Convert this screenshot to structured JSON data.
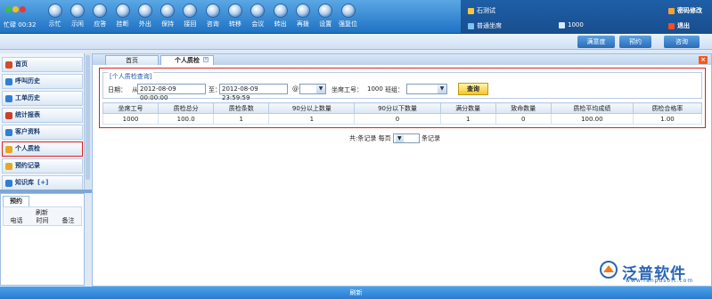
{
  "status": {
    "label": "忙碌",
    "time": "00:32"
  },
  "toolbar": [
    {
      "name": "tool-busy",
      "label": "示忙"
    },
    {
      "name": "tool-idle",
      "label": "示闲"
    },
    {
      "name": "tool-answer",
      "label": "应答"
    },
    {
      "name": "tool-hangup",
      "label": "挂断"
    },
    {
      "name": "tool-outbound",
      "label": "外出"
    },
    {
      "name": "tool-hold",
      "label": "保持"
    },
    {
      "name": "tool-resume",
      "label": "接回"
    },
    {
      "name": "tool-consult",
      "label": "咨询"
    },
    {
      "name": "tool-transfer",
      "label": "转移"
    },
    {
      "name": "tool-conference",
      "label": "会议"
    },
    {
      "name": "tool-transfer-out",
      "label": "转出"
    },
    {
      "name": "tool-redial",
      "label": "再拨"
    },
    {
      "name": "tool-settings",
      "label": "设置"
    },
    {
      "name": "tool-reset",
      "label": "强复位"
    }
  ],
  "user": {
    "name": "石测试",
    "role": "普通坐席",
    "ext": "1000",
    "change_password": "密码修改",
    "logout": "退出"
  },
  "actions": {
    "satisfaction": "满意度",
    "booking": "预约",
    "consult": "咨询"
  },
  "nav": [
    {
      "name": "nav-home",
      "label": "首页"
    },
    {
      "name": "nav-call-history",
      "label": "呼叫历史"
    },
    {
      "name": "nav-work-order",
      "label": "工单历史"
    },
    {
      "name": "nav-reports",
      "label": "统计报表"
    },
    {
      "name": "nav-customers",
      "label": "客户资料"
    },
    {
      "name": "nav-quality",
      "label": "个人质检"
    },
    {
      "name": "nav-booking",
      "label": "预约记录"
    },
    {
      "name": "nav-knowledge",
      "label": "知识库",
      "badge": "[+]"
    }
  ],
  "booking_panel": {
    "tab": "预约",
    "refresh": "刷新",
    "columns": [
      "电话",
      "时间",
      "备注"
    ]
  },
  "tabs": [
    {
      "label": "首页"
    },
    {
      "label": "个人质检"
    }
  ],
  "query": {
    "legend": "[个人质检查询]",
    "date_label": "日期：",
    "from_label": "从",
    "from_value": "2012-08-09 00:00:00",
    "to_label": "至：",
    "to_value": "2012-08-09 23:59:59",
    "at_label": "@",
    "agent_label": "坐席工号：",
    "agent_value": "1000",
    "group_label": "班组：",
    "search_button": "查询"
  },
  "table": {
    "headers": [
      "坐席工号",
      "质检总分",
      "质检条数",
      "90分以上数量",
      "90分以下数量",
      "满分数量",
      "致命数量",
      "质检平均成绩",
      "质检合格率"
    ],
    "rows": [
      [
        "1000",
        "100.0",
        "1",
        "1",
        "0",
        "1",
        "0",
        "100.00",
        "1.00"
      ]
    ]
  },
  "pager": {
    "total": "共:条记录",
    "per_page_label": "每页",
    "per_page": "20",
    "suffix": "条记录"
  },
  "logo": {
    "brand": "泛普软件",
    "url": "www.fanpusoft.com"
  },
  "footer": {
    "text": "刷新"
  },
  "colors": {
    "accent": "#2a7bd0",
    "highlight": "#e02020",
    "button": "#f3c52b"
  }
}
